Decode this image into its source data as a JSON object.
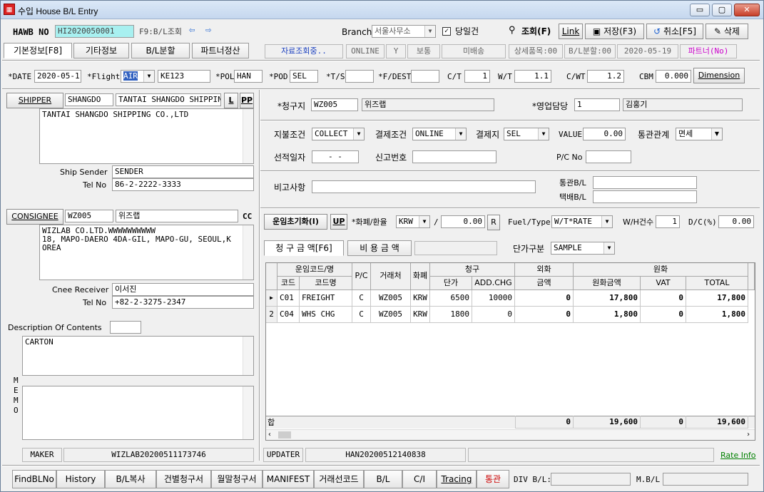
{
  "window": {
    "title": "수입 House B/L Entry",
    "minimize": "▭",
    "maximize": "▢",
    "close": "✕"
  },
  "top": {
    "hawb_label": "HAWB NO",
    "hawb_value": "HI2020050001",
    "f9_hint": "F9:B/L조회",
    "branch_label": "Branch",
    "branch_value": "서울사무소",
    "same_day_label": "당일건",
    "same_day_checked": "✓",
    "search_btn": "조회(F)",
    "link_btn": "Link",
    "save_btn": "저장(F3)",
    "cancel_btn": "취소[F5]",
    "delete_btn": "삭제"
  },
  "tabs": [
    "기본정보[F8]",
    "기타정보",
    "B/L분할",
    "파트너정산"
  ],
  "status": {
    "loading": "자료조회중..",
    "online": "ONLINE",
    "y": "Y",
    "normal": "보통",
    "undelivered": "미배송",
    "detail": "상세품목:00",
    "bl_split": "B/L분할:00",
    "date": "2020-05-19",
    "partner": "파트너(No)"
  },
  "row1": {
    "date_label": "*DATE",
    "date": "2020-05-11",
    "flight_label": "*Flight",
    "flight_type": "AIR",
    "flight_no": "KE123",
    "pol_label": "*POL",
    "pol": "HAN",
    "pod_label": "*POD",
    "pod": "SEL",
    "ts_label": "*T/S",
    "ts": "",
    "fdest_label": "*F/DEST",
    "fdest": "",
    "ct_label": "C/T",
    "ct": "1",
    "wt_label": "W/T",
    "wt": "1.1",
    "cwt_label": "C/WT",
    "cwt": "1.2",
    "cbm_label": "CBM",
    "cbm": "0.000",
    "dimension_btn": "Dimension"
  },
  "shipper": {
    "btn": "SHIPPER",
    "code": "SHANGDO",
    "name": "TANTAI SHANGDO SHIPPING",
    "l_btn": "L",
    "pp_btn": "PP",
    "address": "TANTAI SHANGDO SHIPPING CO.,LTD",
    "sender_label": "Ship Sender",
    "sender": "SENDER",
    "tel_label": "Tel No",
    "tel": "86-2-2222-3333"
  },
  "consignee": {
    "btn": "CONSIGNEE",
    "code": "WZ005",
    "name": "위즈랩",
    "cc": "CC",
    "address": "WIZLAB CO.LTD.WWWWWWWWWW\n18, MAPO-DAERO 4DA-GIL, MAPO-GU, SEOUL,K\nOREA",
    "receiver_label": "Cnee Receiver",
    "receiver": "이서진",
    "tel_label": "Tel No",
    "tel": "+82-2-3275-2347"
  },
  "desc": {
    "label": "Description Of Contents",
    "value": "",
    "contents": "CARTON",
    "memo_label": "MEMO"
  },
  "maker": {
    "label": "MAKER",
    "value": "WIZLAB20200511173746"
  },
  "billing": {
    "bill_to_label": "*청구지",
    "bill_to_code": "WZ005",
    "bill_to_name": "위즈랩",
    "sales_label": "*영업담당",
    "sales_code": "1",
    "sales_name": "김홍기"
  },
  "payment": {
    "pay_cond_label": "지불조건",
    "pay_cond": "COLLECT",
    "settle_cond_label": "결제조건",
    "settle_cond": "ONLINE",
    "settle_place_label": "결제지",
    "settle_place": "SEL",
    "value_label": "VALUE",
    "value": "0.00",
    "customs_label": "통관관계",
    "customs": "면세",
    "ship_date_label": "선적일자",
    "ship_date": " - - ",
    "report_no_label": "신고번호",
    "report_no": "",
    "pc_no_label": "P/C No",
    "pc_no": ""
  },
  "remarks": {
    "label": "비고사항",
    "value": "",
    "customs_bl_label": "통관B/L",
    "customs_bl": "",
    "parcel_bl_label": "택배B/L",
    "parcel_bl": ""
  },
  "freight": {
    "init_btn": "운임초기화(I)",
    "up_btn": "UP",
    "currency_label": "*화폐/환율",
    "currency": "KRW",
    "rate": "0.00",
    "r_btn": "R",
    "fuel_label": "Fuel/Type",
    "fuel": "W/T*RATE",
    "wh_label": "W/H건수",
    "wh": "1",
    "dc_label": "D/C(%)",
    "dc": "0.00"
  },
  "subtabs": {
    "billing": "청 구 금 액[F6]",
    "cost": "비 용 금 액",
    "unit_label": "단가구분",
    "unit": "SAMPLE"
  },
  "grid": {
    "headers": {
      "freight_code_name": "운임코드/명",
      "code": "코드",
      "code_name": "코드명",
      "pc": "P/C",
      "partner": "거래처",
      "currency": "화폐",
      "billing": "청구",
      "unit_price": "단가",
      "add_chg": "ADD.CHG",
      "foreign": "외화",
      "amount": "금액",
      "won": "원화",
      "won_amount": "원화금액",
      "vat": "VAT",
      "total": "TOTAL"
    },
    "rows": [
      {
        "marker": "▶",
        "code": "C01",
        "name": "FREIGHT",
        "pc": "C",
        "partner": "WZ005",
        "cur": "KRW",
        "price": "6500",
        "add": "10000",
        "amount": "0",
        "won": "17,800",
        "vat": "0",
        "total": "17,800"
      },
      {
        "marker": "2",
        "code": "C04",
        "name": "WHS CHG",
        "pc": "C",
        "partner": "WZ005",
        "cur": "KRW",
        "price": "1800",
        "add": "0",
        "amount": "0",
        "won": "1,800",
        "vat": "0",
        "total": "1,800"
      }
    ],
    "sum": {
      "label": "합",
      "amount": "0",
      "won": "19,600",
      "vat": "0",
      "total": "19,600"
    }
  },
  "updater": {
    "label": "UPDATER",
    "value": "HAN20200512140838",
    "rate_info": "Rate Info"
  },
  "bottom": {
    "buttons": [
      "FindBLNo",
      "History",
      "B/L복사",
      "건별청구서",
      "월말청구서",
      "MANIFEST",
      "거래선코드",
      "B/L",
      "C/I",
      "Tracing",
      "통관"
    ],
    "div_bl_label": "DIV B/L:",
    "div_bl": "",
    "mbl_label": "M.B/L",
    "mbl": ""
  },
  "colors": {
    "accent": "#0000cc",
    "highlight_cyan": "#a8f0f0",
    "partner_magenta": "#cc00cc",
    "rate_info_green": "#008000",
    "customs_red": "#cc0000"
  }
}
